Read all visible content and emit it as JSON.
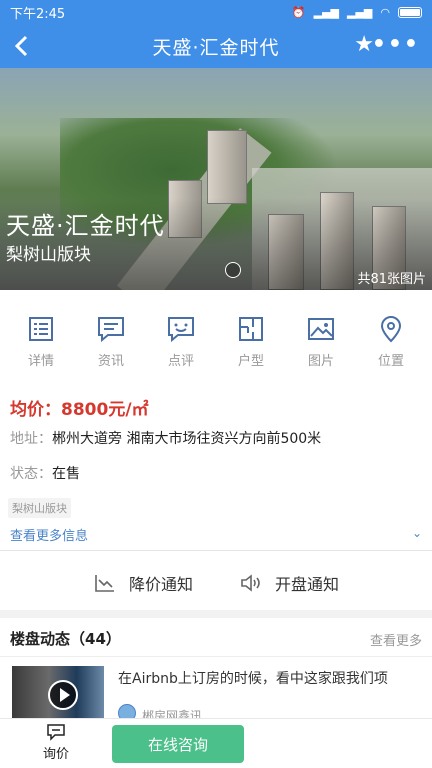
{
  "status_bar": {
    "time": "下午2:45"
  },
  "nav": {
    "title": "天盛·汇金时代"
  },
  "hero": {
    "title": "天盛·汇金时代",
    "subtitle": "梨树山版块",
    "photo_count": "共81张图片"
  },
  "icon_menu": [
    {
      "label": "详情",
      "icon": "details-list-icon"
    },
    {
      "label": "资讯",
      "icon": "news-message-icon"
    },
    {
      "label": "点评",
      "icon": "review-chat-icon"
    },
    {
      "label": "户型",
      "icon": "floorplan-icon"
    },
    {
      "label": "图片",
      "icon": "picture-icon"
    },
    {
      "label": "位置",
      "icon": "location-pin-icon"
    }
  ],
  "property": {
    "price": "均价：8800元/㎡",
    "address_label": "地址：",
    "address_value": "郴州大道旁 湘南大市场往资兴方向前500米",
    "state_label": "状态：",
    "state_value": "在售",
    "tag": "梨树山版块",
    "more_info": "查看更多信息"
  },
  "notify": {
    "price_drop": "降价通知",
    "opening": "开盘通知"
  },
  "dynamics": {
    "heading": "楼盘动态（44）",
    "more": "查看更多",
    "items": [
      {
        "title": "在Airbnb上订房的时候，看中这家跟我们项",
        "author": "郴房网鑫讯"
      }
    ]
  },
  "bottom_bar": {
    "ask_label": "询价",
    "consult_label": "在线咨询"
  },
  "colors": {
    "primary": "#3f8ee8",
    "price": "#d6382e",
    "link": "#4a84c8",
    "consult": "#4bc08a"
  }
}
